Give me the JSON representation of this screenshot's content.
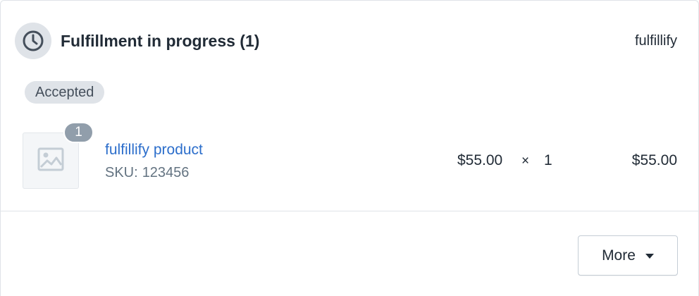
{
  "fulfillment": {
    "status_icon": "clock-icon",
    "title": "Fulfillment in progress (1)",
    "location": "fulfillify",
    "status_badge": "Accepted"
  },
  "line_item": {
    "image_icon": "image-placeholder-icon",
    "quantity_badge": "1",
    "product_name": "fulfillify product",
    "sku_label": "SKU:",
    "sku_value": "123456",
    "unit_price": "$55.00",
    "times_symbol": "×",
    "quantity": "1",
    "line_total": "$55.00"
  },
  "actions": {
    "more_label": "More",
    "more_icon": "caret-down-icon"
  },
  "colors": {
    "link": "#2c6ecb",
    "text": "#212b36",
    "subdued": "#637381",
    "badge_bg": "#dfe3e8",
    "qty_badge_bg": "#919eab"
  }
}
